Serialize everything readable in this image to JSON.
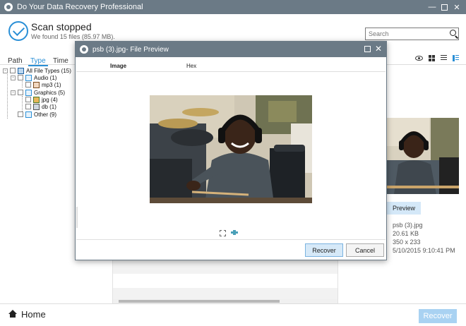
{
  "window": {
    "title": "Do Your Data Recovery Professional"
  },
  "header": {
    "status_title": "Scan stopped",
    "status_sub": "We found 15 files (85.97 MB).",
    "search_placeholder": "Search"
  },
  "tabs": {
    "path": "Path",
    "type": "Type",
    "time": "Time"
  },
  "tree": {
    "all": "All File Types (15)",
    "audio": "Audio (1)",
    "mp3": "mp3 (1)",
    "graphics": "Graphics (5)",
    "jpg": "jpg (4)",
    "db": "db (1)",
    "other": "Other (9)"
  },
  "right_panel": {
    "preview_label": "Preview",
    "file_name": "psb (3).jpg",
    "file_size": "20.61 KB",
    "dimensions": "350 x 233",
    "date": "5/10/2015 9:10:41 PM"
  },
  "bottom": {
    "home_label": "Home",
    "recover_label": "Recover"
  },
  "dialog": {
    "title": "psb (3).jpg- File Preview",
    "tab_image": "Image",
    "tab_hex": "Hex",
    "recover_label": "Recover",
    "cancel_label": "Cancel"
  },
  "colors": {
    "titlebar": "#6b7a86",
    "accent": "#2a8fd6",
    "recover_disabled": "#a9d2f2"
  }
}
